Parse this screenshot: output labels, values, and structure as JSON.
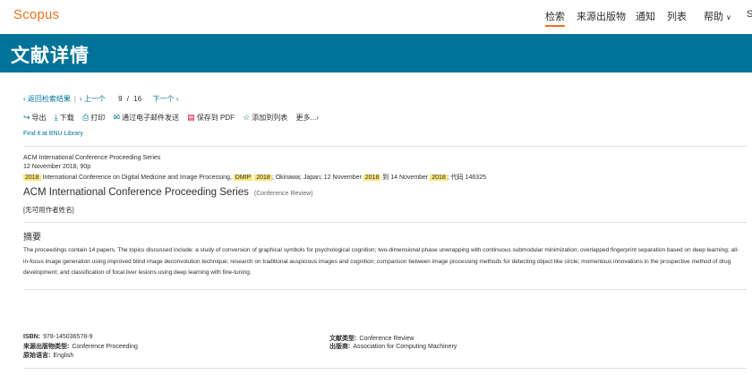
{
  "header": {
    "logo": "Scopus",
    "nav": [
      "检索",
      "来源出版物",
      "通知",
      "列表",
      "帮助",
      "S"
    ]
  },
  "banner": {
    "title": "文献详情"
  },
  "pager": {
    "back": "返回检索结果",
    "prev": "上一个",
    "current": "9",
    "slash": "/",
    "total": "16",
    "next": "下一个"
  },
  "toolbar": {
    "export": "导出",
    "download": "下载",
    "print": "打印",
    "email": "通过电子邮件发送",
    "pdf": "保存到 PDF",
    "list": "添加到列表",
    "more": "更多...",
    "find_it": "Find it at BNU Library"
  },
  "source": {
    "series": "ACM International Conference Proceeding Series",
    "date_pages": "12 November 2018, 90p",
    "conf_year": "2018",
    "conf_name": "International Conference on Digital Medicine and Image Processing,",
    "acronym": "DMIP",
    "acronym_year": "2018",
    "location": "; Okinawa; Japan; 12 November",
    "start_year": "2018",
    "to": "到 14 November",
    "end_year": "2018",
    "code": "; 代码 146325"
  },
  "document": {
    "title": "ACM International Conference Proceeding Series",
    "type": "(Conference Review)",
    "no_author": "[无可用作者姓名]"
  },
  "abstract": {
    "heading": "摘要",
    "text": "The proceedings contain 14 papers. The topics discussed include: a study of conversion of graphical symbols for psychological cognition; two-dimensional phase unwrapping with continuous submodular minimization; overlapped fingerprint separation based on deep learning; all-in-focus image generation using improved blind image deconvolution technique; research on traditional auspicious images and cognition; comparison between image processing methods for detecting object like circle; momentous innovations in the prospective method of drug development; and classification of focal liver lesions using deep learning with fine-tuning."
  },
  "metadata": {
    "isbn_label": "ISBN:",
    "isbn": "978-145036578-9",
    "source_type_label": "来源出版物类型:",
    "source_type": "Conference Proceeding",
    "language_label": "原始语言:",
    "language": "English",
    "doc_type_label": "文献类型:",
    "doc_type": "Conference Review",
    "publisher_label": "出版商:",
    "publisher": "Association for Computing Machinery"
  },
  "colors": {
    "accent": "#e9711c",
    "banner": "#007398",
    "link": "#007398",
    "highlight": "#fbe67b"
  }
}
